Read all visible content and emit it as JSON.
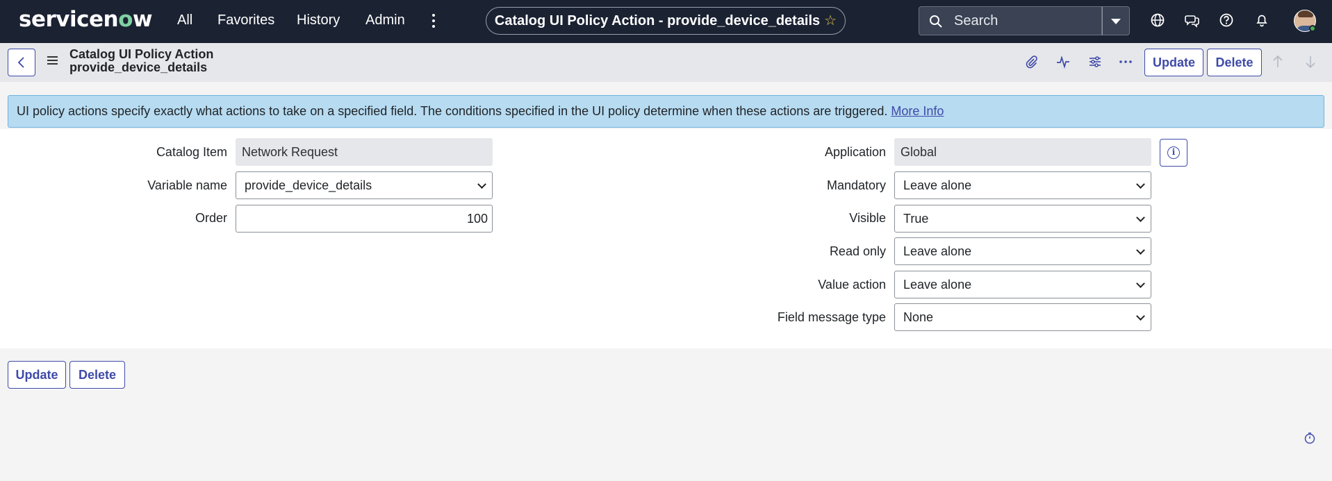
{
  "topnav": {
    "logo_text": "servicenow",
    "menu": [
      "All",
      "Favorites",
      "History",
      "Admin"
    ],
    "context_title": "Catalog UI Policy Action - provide_device_details",
    "search_label": "Search",
    "icons": [
      "globe-icon",
      "chat-icon",
      "help-icon",
      "bell-icon"
    ]
  },
  "header": {
    "title_line1": "Catalog UI Policy Action",
    "title_line2": "provide_device_details",
    "update_label": "Update",
    "delete_label": "Delete"
  },
  "banner": {
    "text": "UI policy actions specify exactly what actions to take on a specified field. The conditions specified in the UI policy determine when these actions are triggered.",
    "link_text": "More Info"
  },
  "form": {
    "left": {
      "catalog_item": {
        "label": "Catalog Item",
        "value": "Network Request"
      },
      "variable_name": {
        "label": "Variable name",
        "value": "provide_device_details"
      },
      "order": {
        "label": "Order",
        "value": "100"
      }
    },
    "right": {
      "application": {
        "label": "Application",
        "value": "Global"
      },
      "mandatory": {
        "label": "Mandatory",
        "value": "Leave alone"
      },
      "visible": {
        "label": "Visible",
        "value": "True"
      },
      "read_only": {
        "label": "Read only",
        "value": "Leave alone"
      },
      "value_action": {
        "label": "Value action",
        "value": "Leave alone"
      },
      "field_message_type": {
        "label": "Field message type",
        "value": "None"
      }
    }
  },
  "footer": {
    "update_label": "Update",
    "delete_label": "Delete"
  },
  "colors": {
    "nav_bg": "#1b2232",
    "accent": "#3e4aa8",
    "banner_bg": "#b7dbf1"
  }
}
